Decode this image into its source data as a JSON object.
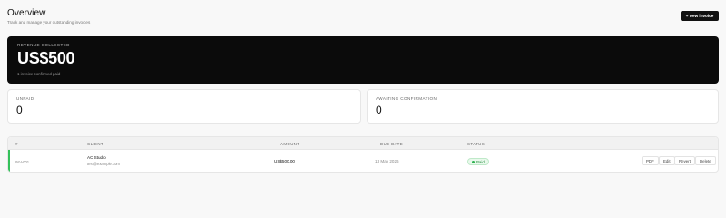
{
  "header": {
    "title": "Overview",
    "subtitle": "Track and manage your outstanding invoices",
    "new_invoice_label": "+ New invoice"
  },
  "revenue": {
    "label": "REVENUE COLLECTED",
    "amount": "US$500",
    "note": "1 invoice confirmed paid"
  },
  "stats": {
    "unpaid": {
      "label": "UNPAID",
      "value": "0"
    },
    "awaiting": {
      "label": "AWAITING CONFIRMATION",
      "value": "0"
    }
  },
  "table": {
    "columns": [
      "#",
      "CLIENT",
      "AMOUNT",
      "DUE DATE",
      "STATUS"
    ],
    "rows": [
      {
        "number": "INV-001",
        "client": "AC Studio",
        "email": "test@example.com",
        "amount": "US$500.00",
        "due_date": "13 May 2026",
        "status": "Paid",
        "actions": [
          "PDF",
          "Edit",
          "Revert",
          "Delete"
        ]
      }
    ]
  },
  "colors": {
    "accent": "#111111",
    "paid": "#34c15a"
  }
}
